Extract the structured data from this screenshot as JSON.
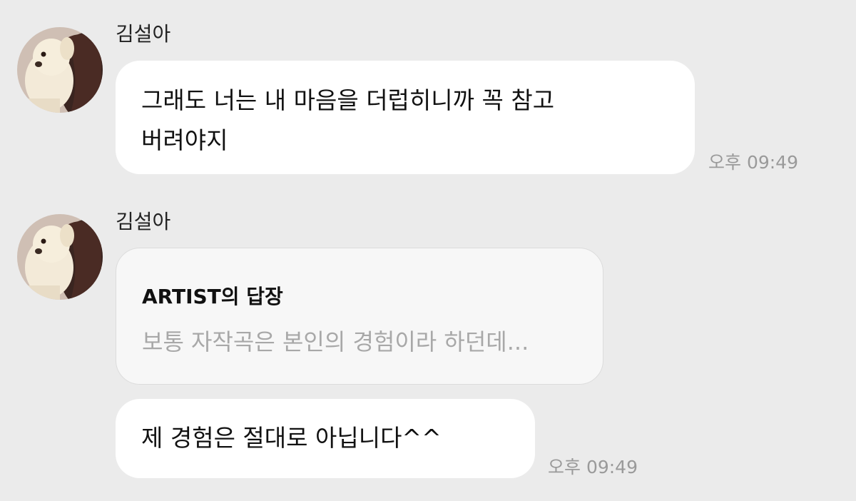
{
  "colors": {
    "background": "#ebebeb",
    "bubble": "#ffffff",
    "reply_card": "#f7f7f7",
    "timestamp": "#9a9a9a",
    "reply_preview": "#a8a8a8"
  },
  "messages": [
    {
      "sender": "김설아",
      "avatar_icon": "dog-photo-avatar",
      "text": "그래도 너는 내 마음을 더럽히니까 꼭 참고\n버려야지",
      "time": "오후 09:49"
    },
    {
      "sender": "김설아",
      "avatar_icon": "dog-photo-avatar",
      "reply": {
        "title": "ARTIST의 답장",
        "preview": "보통 자작곡은 본인의 경험이라 하던데..."
      },
      "text": "제 경험은 절대로 아닙니다^^",
      "time": "오후 09:49"
    }
  ]
}
